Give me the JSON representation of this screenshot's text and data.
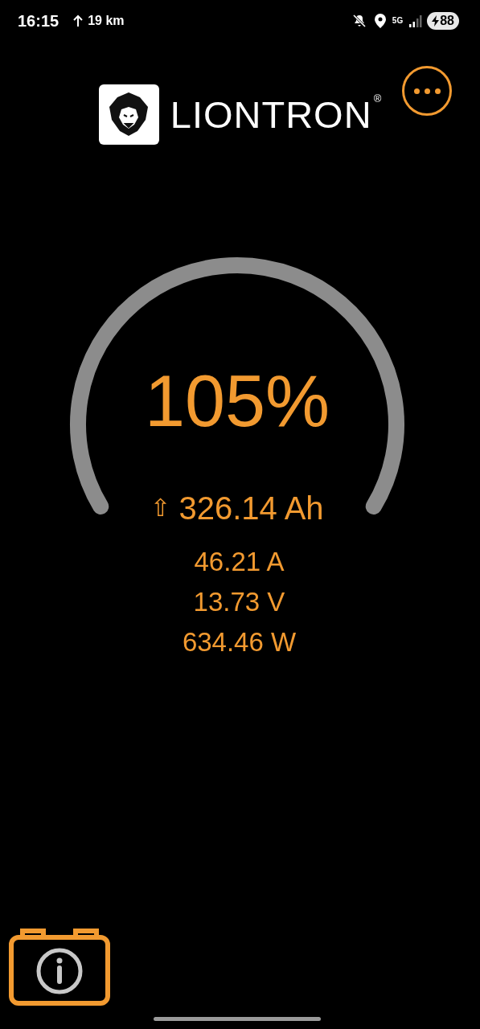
{
  "status_bar": {
    "time": "16:15",
    "distance": "19 km",
    "network": "5G",
    "battery": "88"
  },
  "header": {
    "brand": "LIONTRON",
    "trademark": "®"
  },
  "gauge": {
    "percent": "105%",
    "arrow": "⇧",
    "capacity": "326.14 Ah"
  },
  "readings": [
    "46.21 A",
    "13.73 V",
    "634.46 W"
  ]
}
